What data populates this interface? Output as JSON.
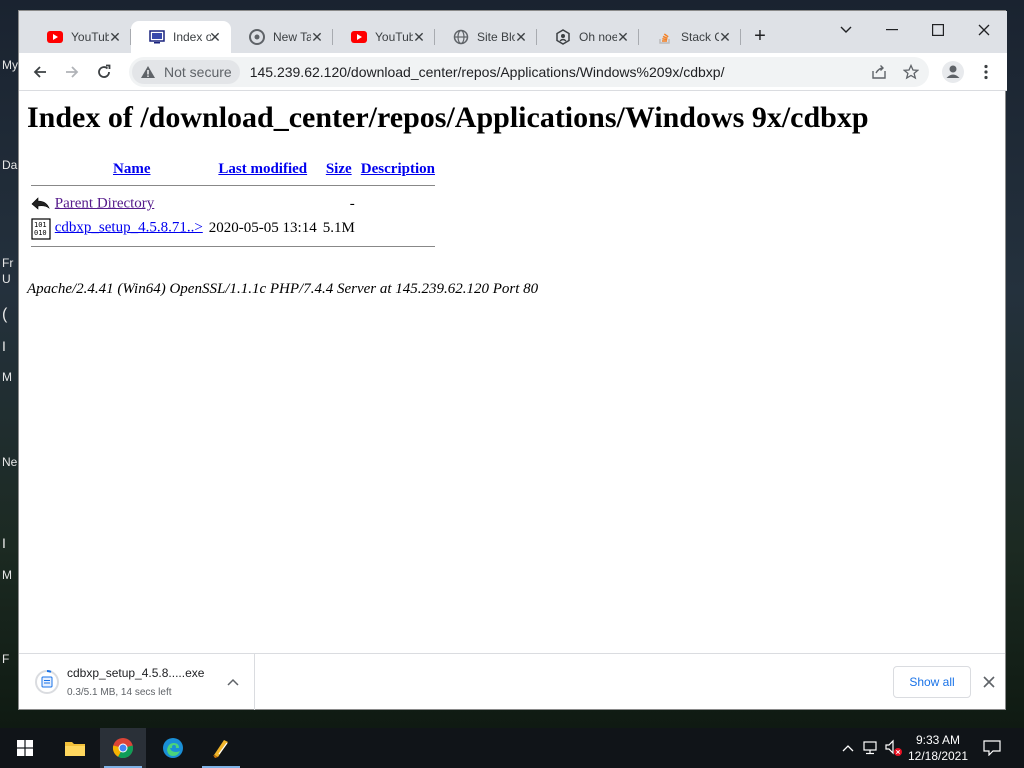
{
  "desktop": {
    "fragments": [
      "My",
      "Da",
      "Fr",
      "U",
      "(",
      "I",
      "M",
      "Ne",
      "I",
      "M",
      "F"
    ]
  },
  "browser": {
    "tabs": [
      {
        "title": "YouTube",
        "icon": "youtube-icon"
      },
      {
        "title": "Index of",
        "icon": "page-icon",
        "active": true
      },
      {
        "title": "New Tab",
        "icon": "chrome-icon"
      },
      {
        "title": "YouTube",
        "icon": "youtube-icon"
      },
      {
        "title": "Site Blocked",
        "icon": "globe-icon"
      },
      {
        "title": "Oh noes",
        "icon": "khan-icon"
      },
      {
        "title": "Stack Overflow",
        "icon": "stackoverflow-icon"
      }
    ],
    "new_tab_label": "+",
    "security_label": "Not secure",
    "url": "145.239.62.120/download_center/repos/Applications/Windows%209x/cdbxp/"
  },
  "page": {
    "title": "Index of /download_center/repos/Applications/Windows 9x/cdbxp",
    "columns": {
      "name": "Name",
      "modified": "Last modified",
      "size": "Size",
      "description": "Description"
    },
    "rows": [
      {
        "name": "Parent Directory",
        "modified": "",
        "size": "-",
        "description": ""
      },
      {
        "name": "cdbxp_setup_4.5.8.71..>",
        "modified": "2020-05-05 13:14",
        "size": "5.1M",
        "description": ""
      }
    ],
    "footer": "Apache/2.4.41 (Win64) OpenSSL/1.1.1c PHP/7.4.4 Server at 145.239.62.120 Port 80"
  },
  "download": {
    "filename": "cdbxp_setup_4.5.8.....exe",
    "status": "0.3/5.1 MB, 14 secs left",
    "show_all": "Show all"
  },
  "taskbar": {
    "time": "9:33 AM",
    "date": "12/18/2021"
  },
  "colors": {
    "link": "#0000ee",
    "visited": "#551a8b",
    "tab_strip": "#dee1e6",
    "accent_blue": "#1a73e8"
  }
}
